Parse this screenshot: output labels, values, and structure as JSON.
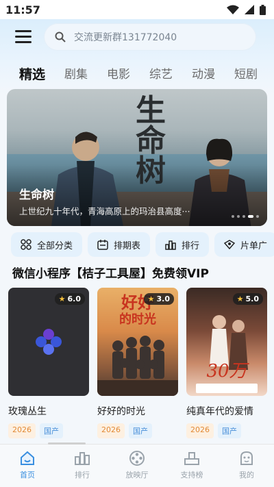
{
  "status_bar": {
    "time": "11:57"
  },
  "search": {
    "placeholder": "交流更新群131772040"
  },
  "tabs": [
    {
      "label": "精选",
      "active": true
    },
    {
      "label": "剧集",
      "active": false
    },
    {
      "label": "电影",
      "active": false
    },
    {
      "label": "综艺",
      "active": false
    },
    {
      "label": "动漫",
      "active": false
    },
    {
      "label": "短剧",
      "active": false
    }
  ],
  "banner": {
    "title": "生命树",
    "description": "上世纪九十年代，青海高原上的玛治县高度···",
    "poster_text": "生命树",
    "slide_count": 5,
    "active_slide": 4
  },
  "quick_actions": [
    {
      "label": "全部分类",
      "icon": "grid-icon"
    },
    {
      "label": "排期表",
      "icon": "calendar-icon"
    },
    {
      "label": "排行",
      "icon": "ranking-icon"
    },
    {
      "label": "片单广",
      "icon": "ticket-icon"
    }
  ],
  "section": {
    "title": "微信小程序【桔子工具屋】免费领VIP"
  },
  "cards": [
    {
      "title": "玫瑰丛生",
      "rating": "6.0",
      "year": "2026",
      "region": "国产"
    },
    {
      "title": "好好的时光",
      "rating": "3.0",
      "year": "2026",
      "region": "国产"
    },
    {
      "title": "纯真年代的爱情",
      "rating": "5.0",
      "year": "2026",
      "region": "国产"
    }
  ],
  "bottom_nav": [
    {
      "label": "首页",
      "icon": "home-icon",
      "active": true
    },
    {
      "label": "排行",
      "icon": "ranking-icon",
      "active": false
    },
    {
      "label": "放映厅",
      "icon": "film-reel-icon",
      "active": false
    },
    {
      "label": "支持榜",
      "icon": "podium-icon",
      "active": false
    },
    {
      "label": "我的",
      "icon": "profile-icon",
      "active": false
    }
  ],
  "colors": {
    "accent": "#3a8fe0",
    "chip_bg": "#e4f1fc",
    "year_tag": "#e28a36",
    "star": "#f7c03c"
  }
}
